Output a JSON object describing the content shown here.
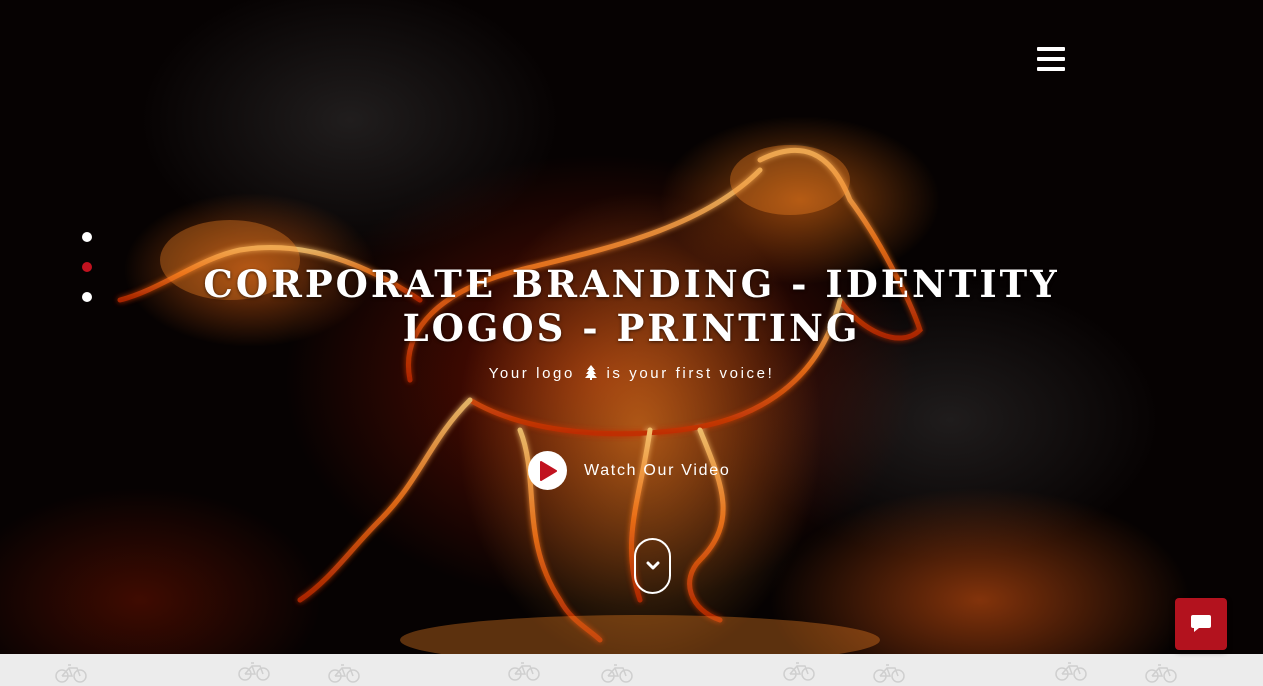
{
  "hero": {
    "headline": "CORPORATE BRANDING - IDENTITY LOGOS - PRINTING",
    "tagline_before": "Your logo",
    "tagline_after": "is your first voice!",
    "tagline_icon": "tree-icon",
    "video_label": "Watch Our Video"
  },
  "navigation": {
    "menu_icon": "hamburger-menu-icon",
    "slide_dots": {
      "count": 3,
      "active_index": 1
    }
  },
  "icons": {
    "play": "play-icon",
    "scroll": "chevron-down-icon",
    "chat": "chat-bubble-icon",
    "pattern": "bicycle-pattern-icon"
  },
  "colors": {
    "accent": "#c1121f",
    "chat_button": "#b3121e",
    "text": "#ffffff",
    "footer_strip": "#ececec"
  }
}
